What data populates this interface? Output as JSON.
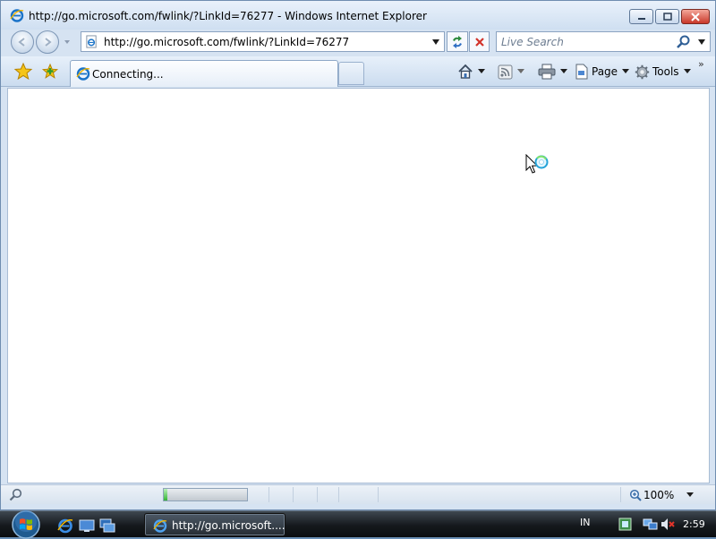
{
  "window": {
    "title": "http://go.microsoft.com/fwlink/?LinkId=76277 - Windows Internet Explorer"
  },
  "address_bar": {
    "url": "http://go.microsoft.com/fwlink/?LinkId=76277"
  },
  "search": {
    "placeholder": "Live Search"
  },
  "tabs": [
    {
      "label": "Connecting..."
    }
  ],
  "command_bar": {
    "page_label": "Page",
    "tools_label": "Tools"
  },
  "status_bar": {
    "progress_fraction": 0.04,
    "zoom": "100%"
  },
  "taskbar": {
    "task_label": "http://go.microsoft....",
    "language": "IN",
    "clock": "2:59"
  },
  "colors": {
    "ie_blue": "#1a73c8",
    "progress_green": "#34b534",
    "close_red": "#c9382a"
  }
}
